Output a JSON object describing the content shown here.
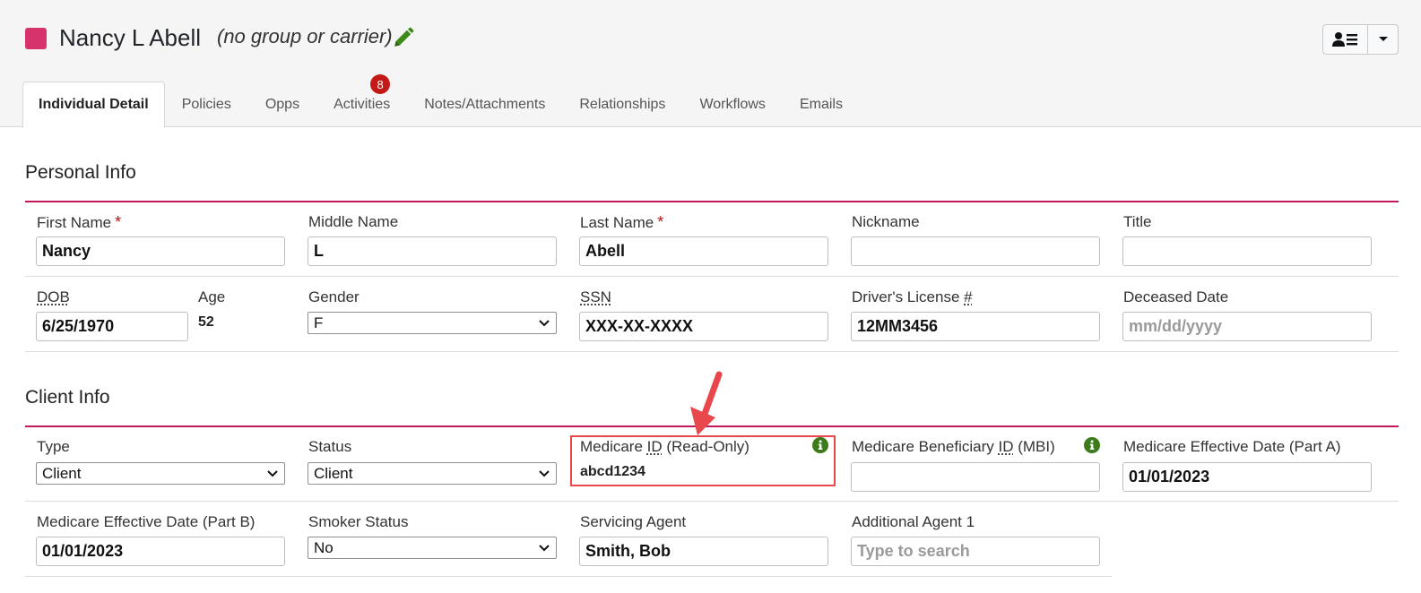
{
  "header": {
    "name": "Nancy L Abell",
    "group": "(no group or carrier)",
    "chip_color": "#d6336c",
    "edit_icon": "pencil-icon",
    "menu_icon": "user-list-icon"
  },
  "tabs": [
    {
      "label": "Individual Detail"
    },
    {
      "label": "Policies"
    },
    {
      "label": "Opps"
    },
    {
      "label": "Activities",
      "badge": "8"
    },
    {
      "label": "Notes/Attachments"
    },
    {
      "label": "Relationships"
    },
    {
      "label": "Workflows"
    },
    {
      "label": "Emails"
    }
  ],
  "personal": {
    "title": "Personal Info",
    "first_name_label": "First Name",
    "first_name": "Nancy",
    "middle_name_label": "Middle Name",
    "middle_name": "L",
    "last_name_label": "Last Name",
    "last_name": "Abell",
    "nickname_label": "Nickname",
    "nickname": "",
    "title_label": "Title",
    "title_value": "",
    "dob_label": "DOB",
    "dob": "6/25/1970",
    "age_label": "Age",
    "age": "52",
    "gender_label": "Gender",
    "gender": "F",
    "ssn_label": "SSN",
    "ssn": "XXX-XX-XXXX",
    "dl_label_prefix": "Driver's License ",
    "dl_label_abbr": "#",
    "dl": "12MM3456",
    "deceased_label": "Deceased Date",
    "deceased_placeholder": "mm/dd/yyyy",
    "required_mark": "*"
  },
  "client": {
    "title": "Client Info",
    "type_label": "Type",
    "type": "Client",
    "status_label": "Status",
    "status": "Client",
    "medicare_id_label_prefix": "Medicare ",
    "medicare_id_label_abbr": "ID",
    "medicare_id_label_suffix": " (Read-Only)",
    "medicare_id": "abcd1234",
    "mbi_label_prefix": "Medicare Beneficiary ",
    "mbi_label_abbr": "ID",
    "mbi_label_suffix": " (MBI)",
    "mbi": "",
    "eff_a_label": "Medicare Effective Date (Part A)",
    "eff_a": "01/01/2023",
    "eff_b_label": "Medicare Effective Date (Part B)",
    "eff_b": "01/01/2023",
    "smoker_label": "Smoker Status",
    "smoker": "No",
    "agent_label": "Servicing Agent",
    "agent": "Smith, Bob",
    "add_agent_label": "Additional Agent 1",
    "add_agent_placeholder": "Type to search"
  },
  "colors": {
    "accent": "#c2185b",
    "highlight": "#e8474b",
    "info": "#3c7a1a",
    "badge": "#c21b17"
  }
}
